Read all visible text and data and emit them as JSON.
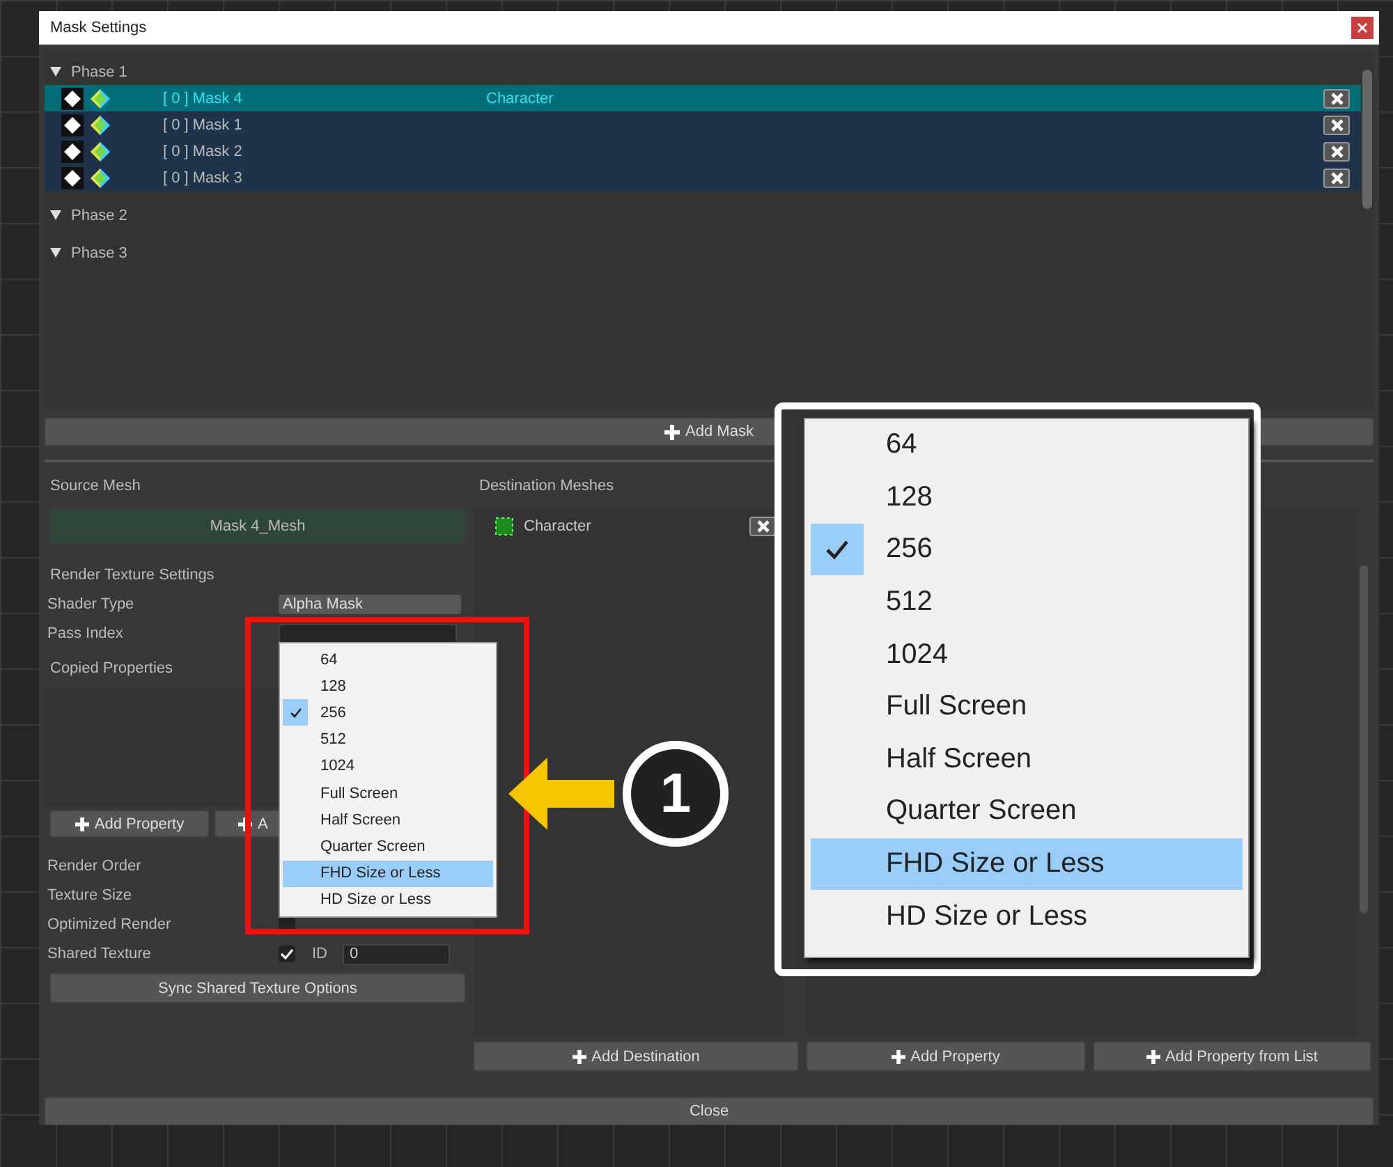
{
  "window": {
    "title": "Mask Settings"
  },
  "phases": [
    {
      "label": "Phase 1",
      "masks": [
        {
          "name": "[ 0 ] Mask 4",
          "target": "Character",
          "selected": true
        },
        {
          "name": "[ 0 ] Mask 1",
          "selected": false
        },
        {
          "name": "[ 0 ] Mask 2",
          "selected": false
        },
        {
          "name": "[ 0 ] Mask 3",
          "selected": false
        }
      ]
    },
    {
      "label": "Phase 2"
    },
    {
      "label": "Phase 3"
    }
  ],
  "add_mask_button": "Add Mask",
  "source_mesh": {
    "title": "Source Mesh",
    "value": "Mask 4_Mesh"
  },
  "render_texture_settings": {
    "title": "Render Texture Settings",
    "shader_type_label": "Shader Type",
    "shader_type_value": "Alpha Mask",
    "pass_index_label": "Pass Index"
  },
  "copied_properties": {
    "title": "Copied Properties",
    "buttons": [
      "Add Property",
      "A"
    ]
  },
  "render_order_label": "Render Order",
  "texture_size_label": "Texture Size",
  "optimized_render": {
    "label": "Optimized Render",
    "checked": false
  },
  "shared_texture": {
    "label": "Shared Texture",
    "checked": true,
    "id_label": "ID",
    "id_value": "0"
  },
  "sync_button": "Sync Shared Texture Options",
  "destination_meshes": {
    "title": "Destination Meshes",
    "items": [
      {
        "name": "Character"
      }
    ],
    "button": "Add Destination"
  },
  "property_buttons": [
    "Add Property",
    "Add Property from List"
  ],
  "close_button": "Close",
  "texture_size_menu": [
    {
      "label": "64",
      "checked": false,
      "highlighted": false
    },
    {
      "label": "128",
      "checked": false,
      "highlighted": false
    },
    {
      "label": "256",
      "checked": true,
      "highlighted": false
    },
    {
      "label": "512",
      "checked": false,
      "highlighted": false
    },
    {
      "label": "1024",
      "checked": false,
      "highlighted": false
    },
    {
      "label": "Full Screen",
      "checked": false,
      "highlighted": false
    },
    {
      "label": "Half Screen",
      "checked": false,
      "highlighted": false
    },
    {
      "label": "Quarter Screen",
      "checked": false,
      "highlighted": false
    },
    {
      "label": "FHD Size or Less",
      "checked": false,
      "highlighted": true
    },
    {
      "label": "HD Size or Less",
      "checked": false,
      "highlighted": false
    }
  ],
  "callout_number": "1",
  "zoomed_menu": [
    {
      "label": "64",
      "checked": false,
      "highlighted": false
    },
    {
      "label": "128",
      "checked": false,
      "highlighted": false
    },
    {
      "label": "256",
      "checked": true,
      "highlighted": false
    },
    {
      "label": "512",
      "checked": false,
      "highlighted": false
    },
    {
      "label": "1024",
      "checked": false,
      "highlighted": false
    },
    {
      "label": "Full Screen",
      "checked": false,
      "highlighted": false
    },
    {
      "label": "Half Screen",
      "checked": false,
      "highlighted": false
    },
    {
      "label": "Quarter Screen",
      "checked": false,
      "highlighted": false
    },
    {
      "label": "FHD Size or Less",
      "checked": false,
      "highlighted": true
    },
    {
      "label": "HD Size or Less",
      "checked": false,
      "highlighted": false
    }
  ]
}
